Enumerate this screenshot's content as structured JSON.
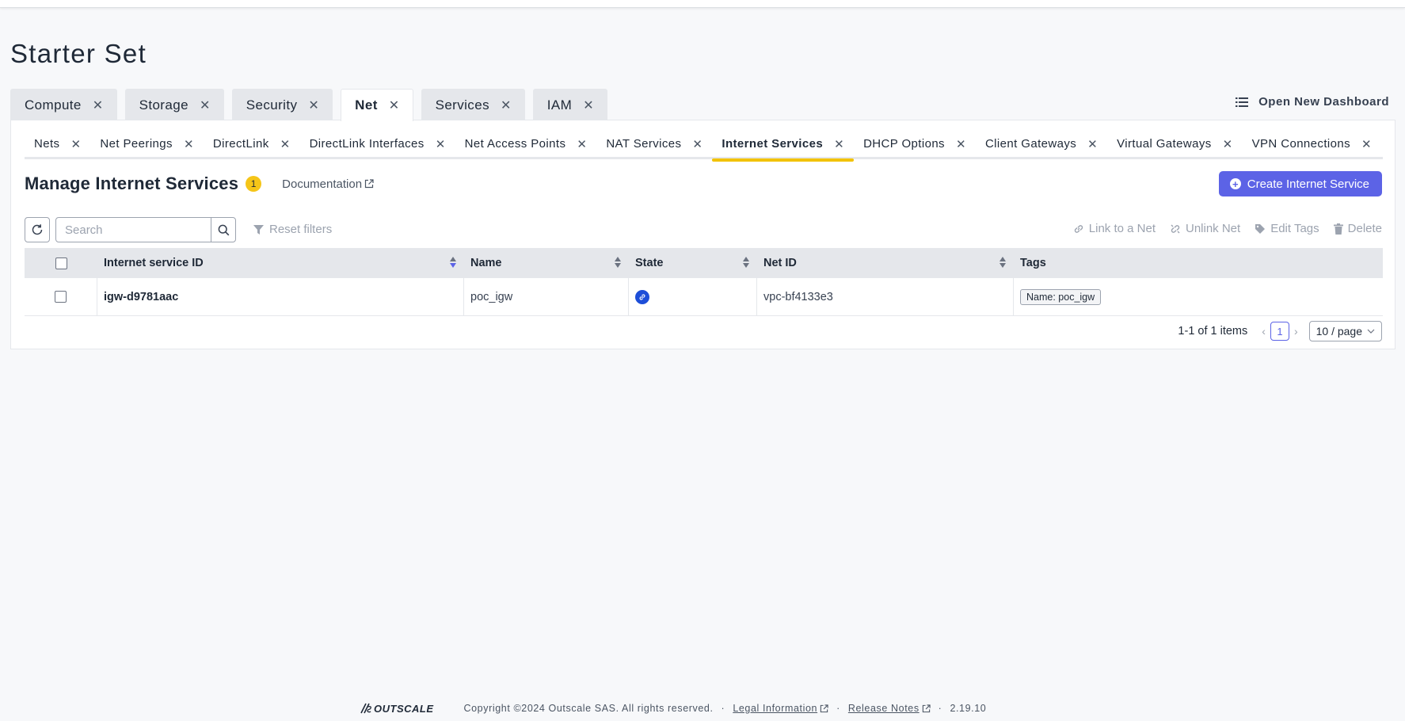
{
  "page": {
    "title": "Starter Set"
  },
  "dashboard_tabs": [
    {
      "label": "Compute",
      "active": false
    },
    {
      "label": "Storage",
      "active": false
    },
    {
      "label": "Security",
      "active": false
    },
    {
      "label": "Net",
      "active": true
    },
    {
      "label": "Services",
      "active": false
    },
    {
      "label": "IAM",
      "active": false
    }
  ],
  "open_dashboard": {
    "label": "Open New Dashboard",
    "icon": "list-icon"
  },
  "sub_tabs": [
    {
      "label": "Nets",
      "active": false
    },
    {
      "label": "Net Peerings",
      "active": false
    },
    {
      "label": "DirectLink",
      "active": false
    },
    {
      "label": "DirectLink Interfaces",
      "active": false
    },
    {
      "label": "Net Access Points",
      "active": false
    },
    {
      "label": "NAT Services",
      "active": false
    },
    {
      "label": "Internet Services",
      "active": true
    },
    {
      "label": "DHCP Options",
      "active": false
    },
    {
      "label": "Client Gateways",
      "active": false
    },
    {
      "label": "Virtual Gateways",
      "active": false
    },
    {
      "label": "VPN Connections",
      "active": false
    }
  ],
  "manage": {
    "title": "Manage Internet Services",
    "count": "1",
    "documentation": "Documentation",
    "create_button": "Create Internet Service"
  },
  "toolbar": {
    "search_placeholder": "Search",
    "search_value": "",
    "reset_filters": "Reset filters",
    "link_to_net": "Link to a Net",
    "unlink_net": "Unlink Net",
    "edit_tags": "Edit Tags",
    "delete": "Delete"
  },
  "table": {
    "columns": {
      "id": "Internet service ID",
      "name": "Name",
      "state": "State",
      "net_id": "Net ID",
      "tags": "Tags"
    },
    "rows": [
      {
        "id": "igw-d9781aac",
        "name": "poc_igw",
        "state_icon": "link-icon",
        "net_id": "vpc-bf4133e3",
        "tag": "Name: poc_igw"
      }
    ]
  },
  "pagination": {
    "range": "1-1 of 1 items",
    "current_page": "1",
    "page_size": "10 / page"
  },
  "footer": {
    "logo": "OUTSCALE",
    "copyright": "Copyright ©2024 Outscale SAS. All rights reserved.",
    "legal": "Legal Information",
    "release_notes": "Release Notes",
    "version": "2.19.10",
    "separator": "·"
  },
  "colors": {
    "accent": "#5c63e6",
    "active_tab_underline": "#f2c200",
    "badge": "#f5c518",
    "state_icon": "#1d4ed8"
  }
}
